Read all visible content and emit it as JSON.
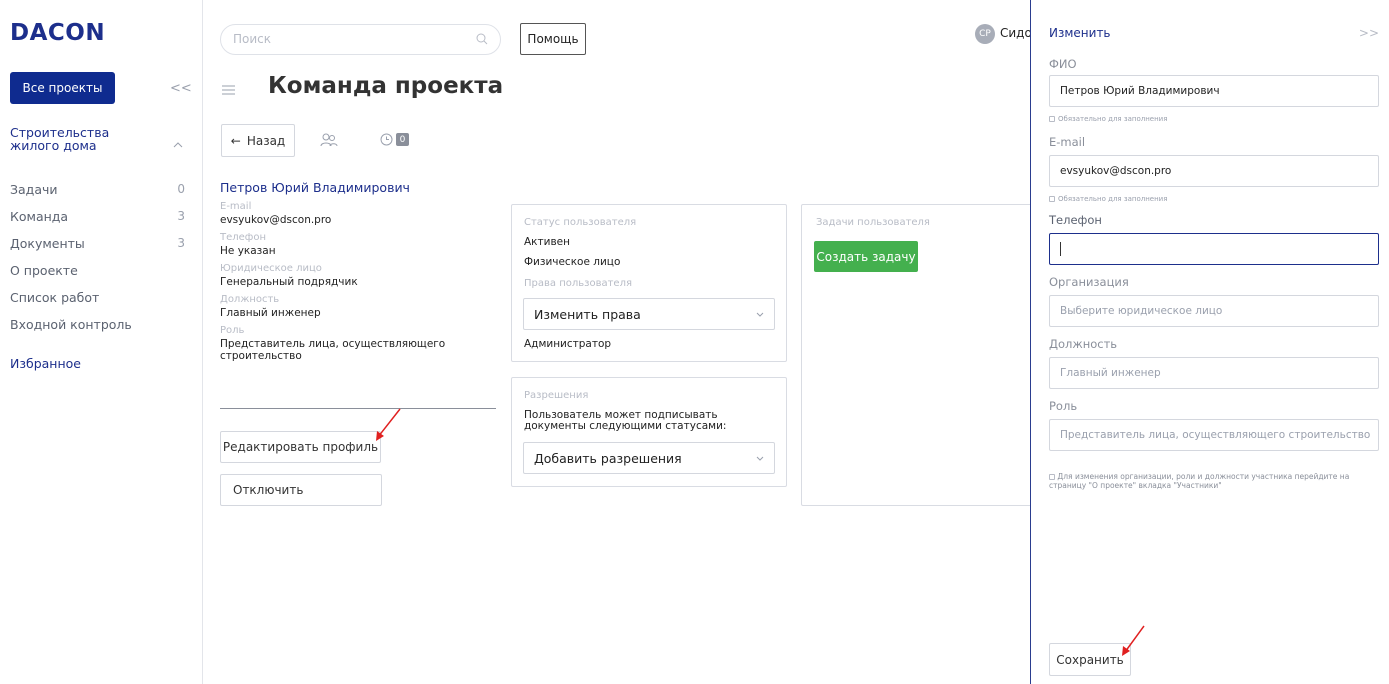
{
  "sidebar": {
    "logo": "DACON",
    "all_projects_label": "Все проекты",
    "collapse_glyph": "<<",
    "project_name": "Строительства жилого дома",
    "items": [
      {
        "label": "Задачи",
        "count": "0"
      },
      {
        "label": "Команда",
        "count": "3"
      },
      {
        "label": "Документы",
        "count": "3"
      },
      {
        "label": "О проекте",
        "count": ""
      },
      {
        "label": "Список работ",
        "count": ""
      },
      {
        "label": "Входной контроль",
        "count": ""
      }
    ],
    "favorites_label": "Избранное"
  },
  "topbar": {
    "search_placeholder": "Поиск",
    "help_label": "Помощь",
    "avatar_initials": "СР",
    "user_name": "Сидо"
  },
  "page": {
    "title": "Команда проекта",
    "back_label": "Назад",
    "clock_count": "0"
  },
  "profile": {
    "name": "Петров Юрий Владимирович",
    "fields": [
      {
        "label": "E-mail",
        "value": "evsyukov@dscon.pro"
      },
      {
        "label": "Телефон",
        "value": "Не указан"
      },
      {
        "label": "Юридическое лицо",
        "value": "Генеральный подрядчик"
      },
      {
        "label": "Должность",
        "value": "Главный инженер"
      },
      {
        "label": "Роль",
        "value": "Представитель лица, осуществляющего строительство"
      }
    ],
    "edit_label": "Редактировать профиль",
    "disable_label": "Отключить"
  },
  "status_card": {
    "label": "Статус пользователя",
    "status": "Активен",
    "person_type": "Физическое лицо",
    "rights_label": "Права пользователя",
    "rights_dropdown": "Изменить права",
    "rights_value": "Администратор"
  },
  "permissions_card": {
    "label": "Разрешения",
    "text": "Пользователь может подписывать документы следующими статусами:",
    "dropdown": "Добавить разрешения"
  },
  "tasks_card": {
    "label": "Задачи пользователя",
    "create_label": "Создать задачу"
  },
  "drawer": {
    "title": "Изменить",
    "close_glyph": ">>",
    "fio_label": "ФИО",
    "fio_value": "Петров Юрий Владимирович",
    "required_hint": "Обязательно для заполнения",
    "email_label": "E-mail",
    "email_value": "evsyukov@dscon.pro",
    "phone_label": "Телефон",
    "phone_value": "",
    "org_label": "Организация",
    "org_placeholder": "Выберите юридическое лицо",
    "position_label": "Должность",
    "position_value": "Главный инженер",
    "role_label": "Роль",
    "role_value": "Представитель лица, осуществляющего строительство",
    "note": "Для изменения организации, роли и должности участника перейдите на страницу \"О проекте\" вкладка \"Участники\"",
    "save_label": "Сохранить"
  },
  "colors": {
    "brand": "#1d2f8c",
    "primary_button": "#0f2b8f",
    "success": "#44b04e",
    "annotation_arrow": "#e02020"
  }
}
